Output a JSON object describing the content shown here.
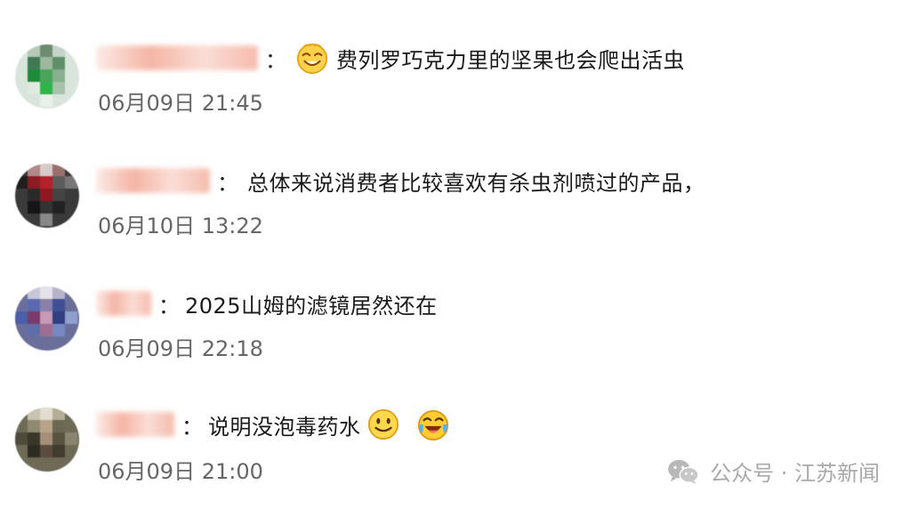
{
  "comments": [
    {
      "username": "用户名已模糊",
      "text": "费列罗巧克力里的坚果也会爬出活虫",
      "time": "06月09日 21:45",
      "leading_emoji": "grin-face-icon",
      "trailing_emoji": ""
    },
    {
      "username": "用户名已模糊",
      "text": "总体来说消费者比较喜欢有杀虫剂喷过的产品，",
      "time": "06月10日 13:22",
      "leading_emoji": "",
      "trailing_emoji": ""
    },
    {
      "username": "用户名已模糊",
      "text": "2025山姆的滤镜居然还在",
      "time": "06月09日 22:18",
      "leading_emoji": "",
      "trailing_emoji": ""
    },
    {
      "username": "用户名已模糊",
      "text": "说明没泡毒药水",
      "time": "06月09日 21:00",
      "leading_emoji": "",
      "trailing_emoji": "smile-face-icon laugh-cry-face-icon"
    }
  ],
  "footer": {
    "brand": "公众号 · 江苏新闻"
  },
  "colors": {
    "username_blur": "#eb785a",
    "text": "#1a1a1a",
    "time": "#666666",
    "footer": "#a9a9a9"
  }
}
